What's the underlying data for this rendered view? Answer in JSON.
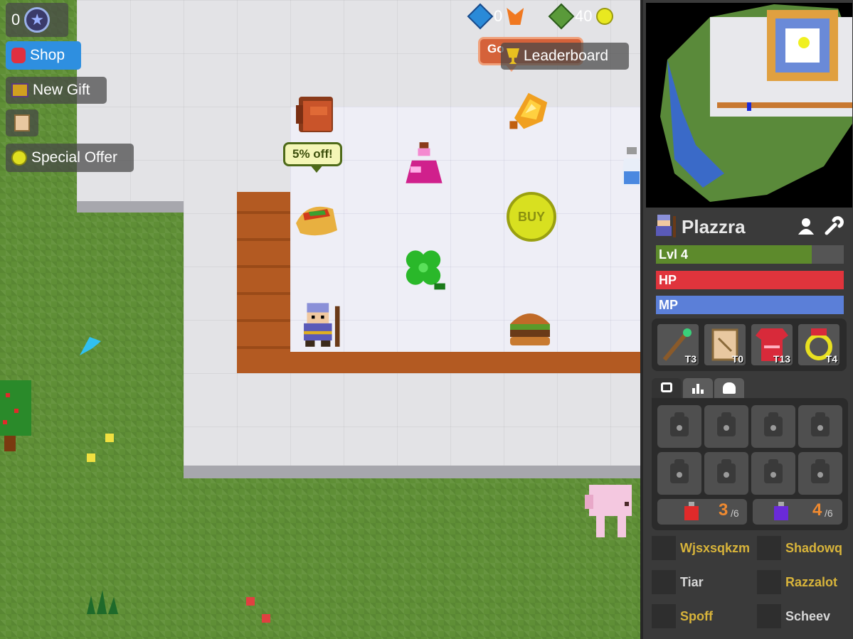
{
  "hud": {
    "fame_count": "0",
    "shop_label": "Shop",
    "new_gift_label": "New Gift",
    "special_offer_label": "Special Offer",
    "info_count": "0",
    "gold_count": "40",
    "leaderboard_label": "Leaderboard",
    "good_label": "Go"
  },
  "shop": {
    "discount_text": "5% off!",
    "buy_text": "BUY"
  },
  "character": {
    "name": "Plazzra",
    "level_label": "Lvl 4",
    "level_progress": 0.83,
    "hp_label": "HP",
    "mp_label": "MP",
    "colors": {
      "level": "#5d8a2c",
      "hp": "#e0343c",
      "mp": "#5b7fd8"
    }
  },
  "equipment": [
    {
      "name": "staff",
      "tier": "T3"
    },
    {
      "name": "spell scroll",
      "tier": "T0"
    },
    {
      "name": "robe",
      "tier": "T13"
    },
    {
      "name": "ring",
      "tier": "T4"
    }
  ],
  "potions": {
    "health_count": "3",
    "health_max": "/6",
    "magic_count": "4",
    "magic_max": "/6"
  },
  "players": [
    {
      "name": "Wjsxsqkzm",
      "color": "#d8b43a"
    },
    {
      "name": "Shadowq",
      "color": "#d8b43a"
    },
    {
      "name": "Tiar",
      "color": "#d8d8d8"
    },
    {
      "name": "Razzalot",
      "color": "#d8b43a"
    },
    {
      "name": "Spoff",
      "color": "#d8b43a"
    },
    {
      "name": "Scheev",
      "color": "#d8d8d8"
    }
  ]
}
